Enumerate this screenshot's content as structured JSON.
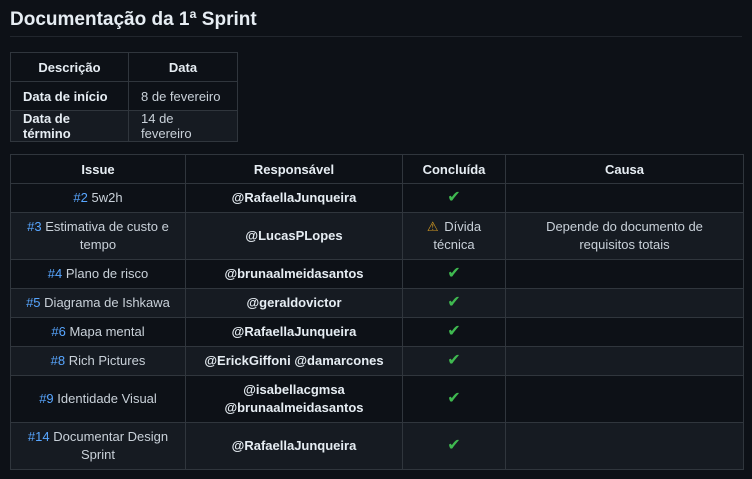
{
  "title": "Documentação da 1ª Sprint",
  "dates_table": {
    "headers": [
      "Descrição",
      "Data"
    ],
    "rows": [
      {
        "label": "Data de início",
        "value": "8 de fevereiro"
      },
      {
        "label": "Data de término",
        "value": "14 de fevereiro"
      }
    ]
  },
  "issues_table": {
    "headers": [
      "Issue",
      "Responsável",
      "Concluída",
      "Causa"
    ],
    "rows": [
      {
        "num": "#2",
        "name": "5w2h",
        "resp": "@RafaellaJunqueira",
        "done": "✔",
        "status_icon": "",
        "status_text": "",
        "cause": ""
      },
      {
        "num": "#3",
        "name": "Estimativa de custo e tempo",
        "resp": "@LucasPLopes",
        "done": "",
        "status_icon": "⚠",
        "status_text": "Dívida técnica",
        "cause": "Depende do documento de requisitos totais"
      },
      {
        "num": "#4",
        "name": "Plano de risco",
        "resp": "@brunaalmeidasantos",
        "done": "✔",
        "status_icon": "",
        "status_text": "",
        "cause": ""
      },
      {
        "num": "#5",
        "name": "Diagrama de Ishkawa",
        "resp": "@geraldovictor",
        "done": "✔",
        "status_icon": "",
        "status_text": "",
        "cause": ""
      },
      {
        "num": "#6",
        "name": "Mapa mental",
        "resp": "@RafaellaJunqueira",
        "done": "✔",
        "status_icon": "",
        "status_text": "",
        "cause": ""
      },
      {
        "num": "#8",
        "name": "Rich Pictures",
        "resp": "@ErickGiffoni @damarcones",
        "done": "✔",
        "status_icon": "",
        "status_text": "",
        "cause": ""
      },
      {
        "num": "#9",
        "name": "Identidade Visual",
        "resp_lines": [
          "@isabellacgmsa",
          "@brunaalmeidasantos"
        ],
        "done": "✔",
        "status_icon": "",
        "status_text": "",
        "cause": ""
      },
      {
        "num": "#14",
        "name": "Documentar Design Sprint",
        "resp": "@RafaellaJunqueira",
        "done": "✔",
        "status_icon": "",
        "status_text": "",
        "cause": ""
      }
    ]
  },
  "colors": {
    "background": "#0d1117",
    "link": "#58a6ff",
    "check": "#3fb950",
    "warning": "#d29922",
    "border": "#30363d"
  }
}
